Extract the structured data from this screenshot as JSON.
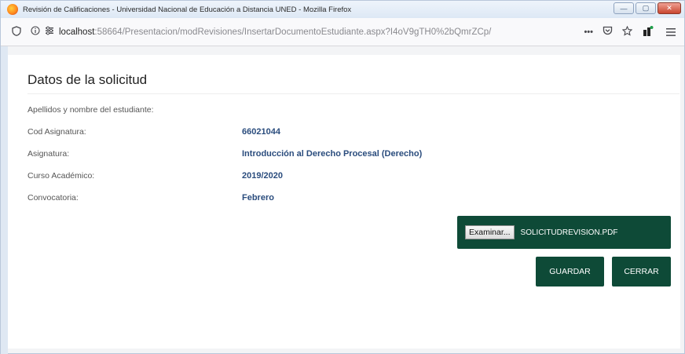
{
  "window": {
    "title": "Revisión de Calificaciones - Universidad Nacional de Educación a Distancia UNED - Mozilla Firefox",
    "controls": {
      "minimize": "—",
      "maximize": "▢",
      "close": "✕"
    }
  },
  "browser": {
    "url_host": "localhost",
    "url_rest": ":58664/Presentacion/modRevisiones/InsertarDocumentoEstudiante.aspx?I4oV9gTH0%2bQmrZCp/",
    "more_icon": "•••"
  },
  "page": {
    "title": "Datos de la solicitud",
    "fields": [
      {
        "label": "Apellidos y nombre del estudiante:",
        "value": ""
      },
      {
        "label": "Cod Asignatura:",
        "value": "66021044"
      },
      {
        "label": "Asignatura:",
        "value": "Introducción al Derecho Procesal (Derecho)"
      },
      {
        "label": "Curso Académico:",
        "value": "2019/2020"
      },
      {
        "label": "Convocatoria:",
        "value": "Febrero"
      }
    ],
    "upload": {
      "browse_label": "Examinar...",
      "file_name": "SOLICITUDREVISION.PDF"
    },
    "buttons": {
      "save": "GUARDAR",
      "close": "CERRAR"
    }
  },
  "colors": {
    "accent": "#0e4a37",
    "value_text": "#2a4c7d"
  }
}
